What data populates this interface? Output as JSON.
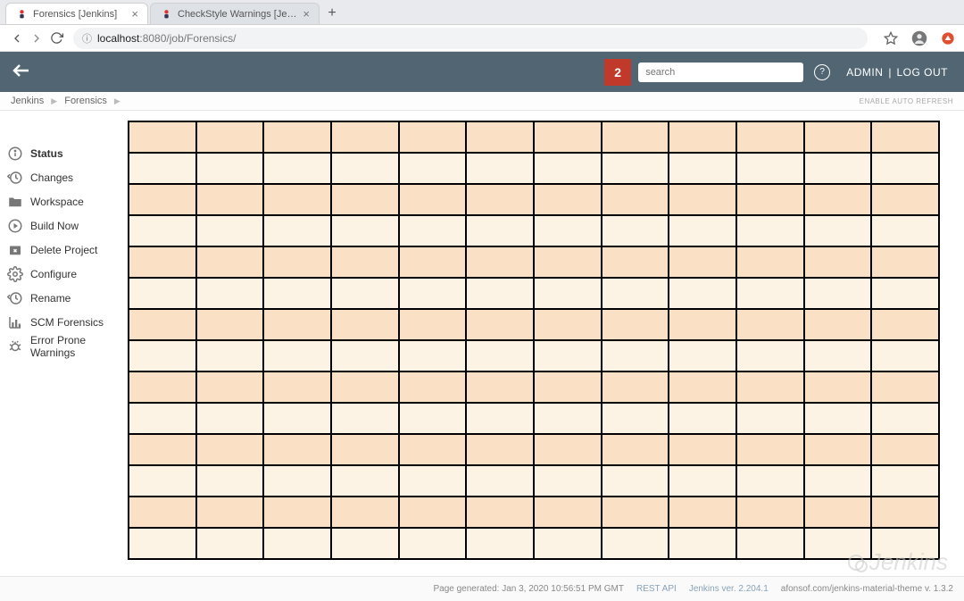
{
  "browser": {
    "tabs": [
      {
        "title": "Forensics [Jenkins]",
        "active": true
      },
      {
        "title": "CheckStyle Warnings [Jenkins]",
        "active": false
      }
    ],
    "url_prefix_icon": "ⓘ",
    "url_host_prefix": "localhost",
    "url_host_port": ":8080",
    "url_path": "/job/Forensics/"
  },
  "header": {
    "notif_count": "2",
    "search_placeholder": "search",
    "admin_label": "ADMIN",
    "logout_label": "LOG OUT"
  },
  "breadcrumbs": {
    "items": [
      "Jenkins",
      "Forensics"
    ],
    "auto_refresh": "ENABLE AUTO REFRESH"
  },
  "sidebar": {
    "items": [
      {
        "label": "Status",
        "icon": "info",
        "active": true
      },
      {
        "label": "Changes",
        "icon": "history",
        "active": false
      },
      {
        "label": "Workspace",
        "icon": "folder",
        "active": false
      },
      {
        "label": "Build Now",
        "icon": "play",
        "active": false
      },
      {
        "label": "Delete Project",
        "icon": "delete",
        "active": false
      },
      {
        "label": "Configure",
        "icon": "gear",
        "active": false
      },
      {
        "label": "Rename",
        "icon": "history",
        "active": false
      },
      {
        "label": "SCM Forensics",
        "icon": "chart",
        "active": false
      },
      {
        "label": "Error Prone Warnings",
        "icon": "bug",
        "active": false
      }
    ]
  },
  "grid": {
    "rows": 14,
    "cols": 12
  },
  "footer": {
    "generated": "Page generated: Jan 3, 2020 10:56:51 PM GMT",
    "rest_api": "REST API",
    "version": "Jenkins ver. 2.204.1",
    "theme": "afonsof.com/jenkins-material-theme v. 1.3.2"
  },
  "watermark": "Jenkins"
}
